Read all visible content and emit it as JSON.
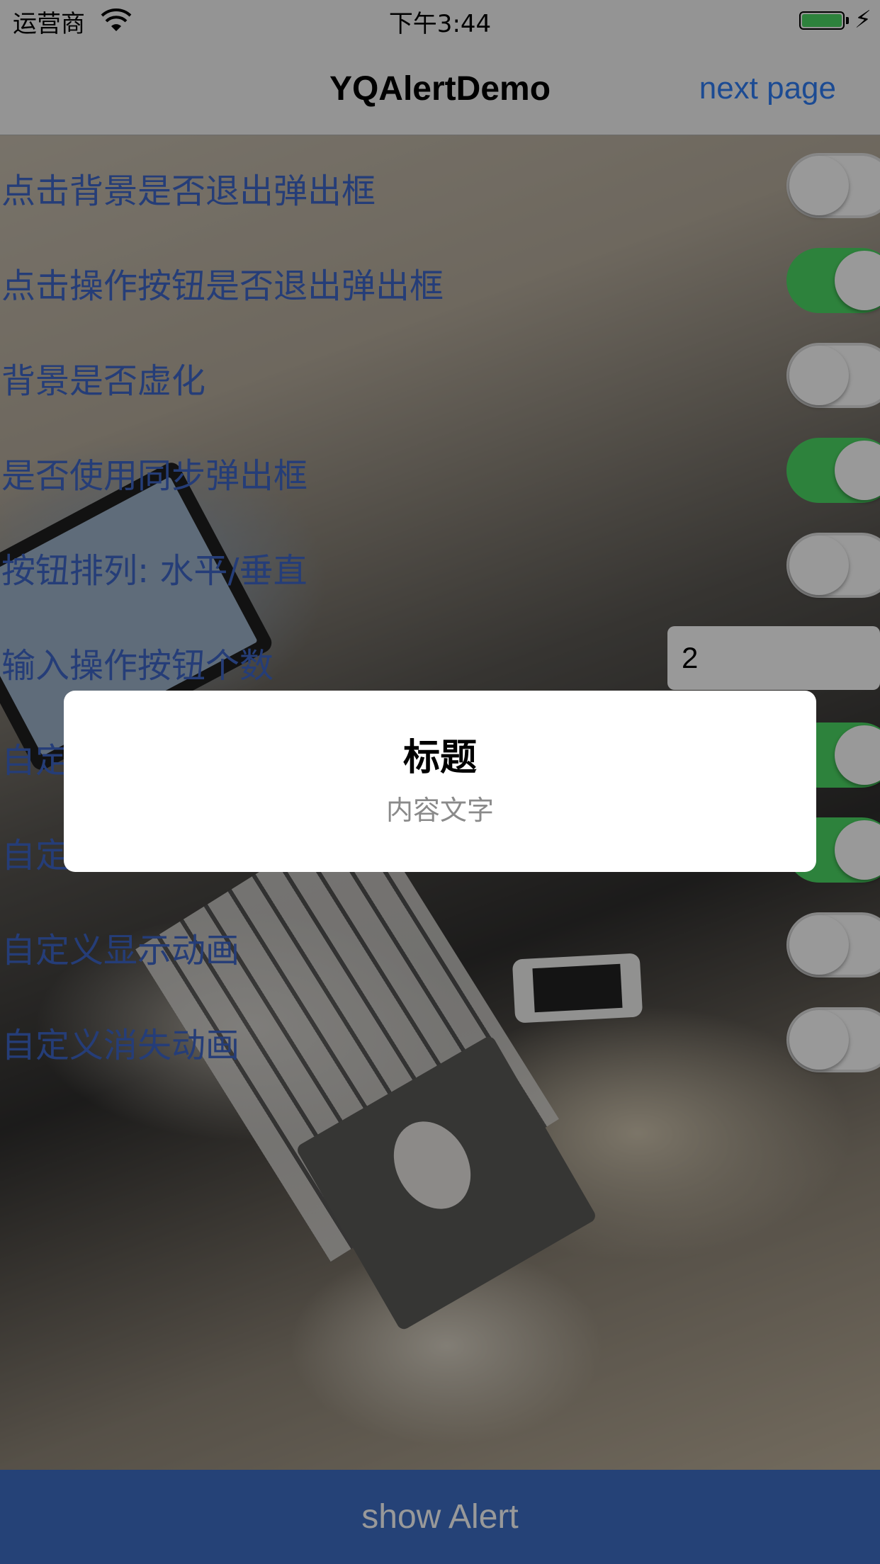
{
  "status_bar": {
    "carrier": "运营商",
    "time": "下午3:44",
    "battery_color": "#4cd964"
  },
  "nav": {
    "title": "YQAlertDemo",
    "next_label": "next page"
  },
  "settings": {
    "rows": [
      {
        "label": "点击背景是否退出弹出框",
        "control": "switch",
        "on": false
      },
      {
        "label": "点击操作按钮是否退出弹出框",
        "control": "switch",
        "on": true
      },
      {
        "label": "背景是否虚化",
        "control": "switch",
        "on": false
      },
      {
        "label": "是否使用同步弹出框",
        "control": "switch",
        "on": true
      },
      {
        "label": "按钮排列: 水平/垂直",
        "control": "switch",
        "on": false
      },
      {
        "label": "输入操作按钮个数",
        "control": "number",
        "value": "2"
      },
      {
        "label": "自定",
        "control": "switch",
        "on": true
      },
      {
        "label": "自定",
        "control": "switch",
        "on": true
      },
      {
        "label": "自定义显示动画",
        "control": "switch",
        "on": false
      },
      {
        "label": "自定义消失动画",
        "control": "switch",
        "on": false
      }
    ]
  },
  "show_button": {
    "label": "show Alert"
  },
  "alert": {
    "title": "标题",
    "message": "内容文字"
  },
  "colors": {
    "accent": "#2f7df6",
    "label_blue": "#3e67c8",
    "switch_on": "#4cd964",
    "button_bg": "#3e6fc6"
  }
}
